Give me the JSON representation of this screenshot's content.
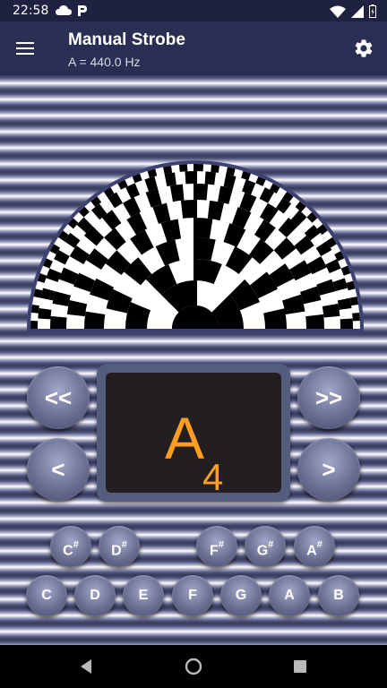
{
  "status": {
    "time": "22:58"
  },
  "app": {
    "title": "Manual Strobe",
    "subtitle": "A = 440.0 Hz"
  },
  "display": {
    "note": "A",
    "octave": "4"
  },
  "controls": {
    "prev_octave": "<<",
    "next_octave": ">>",
    "prev_note": "<",
    "next_note": ">"
  },
  "sharps": [
    {
      "name": "C",
      "symbol": "#"
    },
    {
      "name": "D",
      "symbol": "#"
    },
    {
      "name": "F",
      "symbol": "#"
    },
    {
      "name": "G",
      "symbol": "#"
    },
    {
      "name": "A",
      "symbol": "#"
    }
  ],
  "naturals": [
    "C",
    "D",
    "E",
    "F",
    "G",
    "A",
    "B"
  ],
  "colors": {
    "app_bar": "#2a2e52",
    "status_bar": "#1e2240",
    "note": "#ff9e22",
    "display_bg": "#231e1f",
    "strobe_border": "#3d4170"
  },
  "icons": {
    "status_left": [
      "cloud-icon",
      "parking-icon"
    ],
    "status_right": [
      "wifi-icon",
      "signal-icon",
      "battery-icon"
    ],
    "app_bar": [
      "menu-icon",
      "settings-icon"
    ],
    "nav": [
      "back-icon",
      "home-icon",
      "recents-icon"
    ]
  }
}
